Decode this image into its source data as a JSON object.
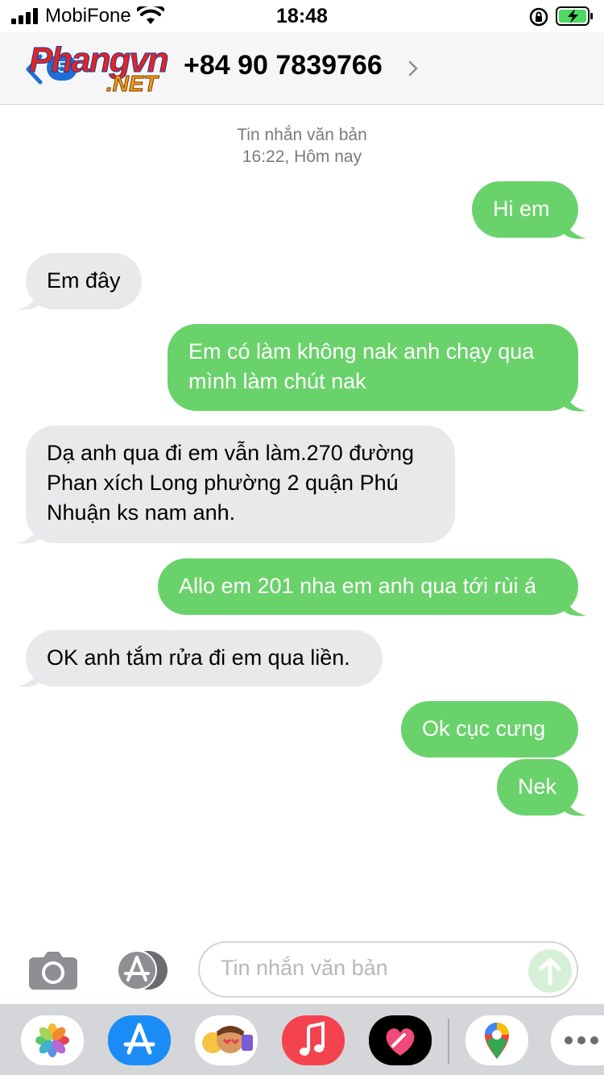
{
  "status_bar": {
    "carrier": "MobiFone",
    "time": "18:48"
  },
  "header": {
    "back_badge": "5",
    "watermark_line1": "Phangvn",
    "watermark_line2": ".NET",
    "contact": "+84 90 7839766"
  },
  "thread": {
    "meta_line1": "Tin nhắn văn bản",
    "meta_line2": "16:22, Hôm nay",
    "messages": [
      {
        "dir": "out",
        "text": "Hi em"
      },
      {
        "dir": "in",
        "text": "Em đây"
      },
      {
        "dir": "out",
        "line1": "Em có làm không nak anh chạy qua",
        "line2": "mình làm chút nak"
      },
      {
        "dir": "in",
        "line1": "Dạ anh qua đi em vẫn làm.270 đường",
        "line2": "Phan xích Long phường 2 quận Phú",
        "line3": "Nhuận ks nam anh."
      },
      {
        "dir": "out",
        "text": "Allo em 201 nha em anh qua tới rùi á"
      },
      {
        "dir": "in",
        "text": "OK anh tắm rửa đi em qua liền."
      },
      {
        "dir": "out",
        "text": "Ok cục cưng"
      },
      {
        "dir": "out",
        "text": "Nek"
      }
    ]
  },
  "composer": {
    "placeholder": "Tin nhắn văn bản"
  },
  "dock": {
    "apps": [
      "photos-app",
      "app-store-app",
      "memoji-app",
      "music-app",
      "heart-app",
      "maps-app",
      "more-apps"
    ]
  },
  "colors": {
    "outgoing_bubble": "#6ad26b",
    "incoming_bubble": "#e9e9eb",
    "accent_blue": "#1f6fd6"
  }
}
